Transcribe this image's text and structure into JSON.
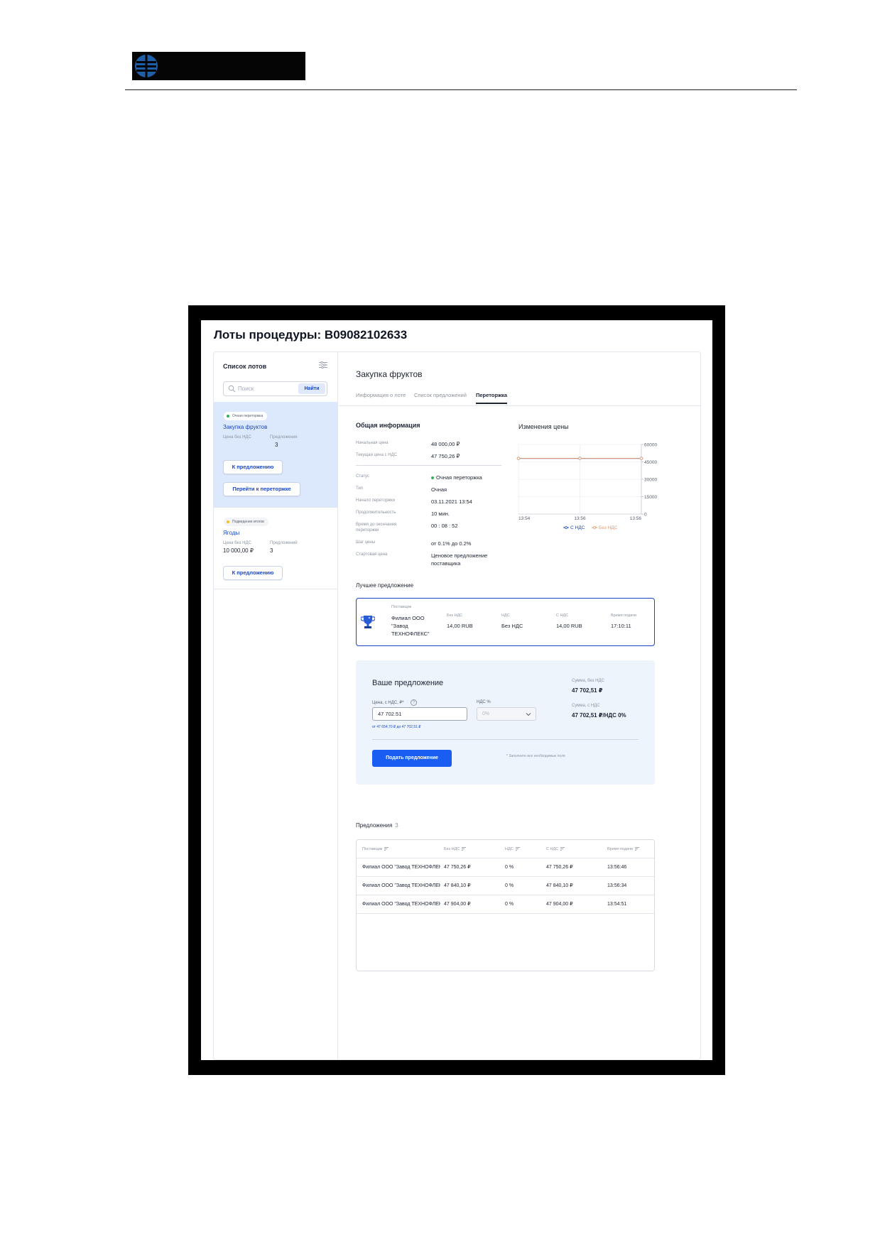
{
  "document": {
    "logo": {
      "brand_color": "#1f5fa8"
    }
  },
  "app": {
    "page_title": "Лоты процедуры: В09082102633"
  },
  "sidebar": {
    "title": "Список лотов",
    "search": {
      "placeholder": "Поиск",
      "button": "Найти"
    },
    "lots": [
      {
        "status": "Очная переторжка",
        "status_color": "#2db35a",
        "name": "Закупка фруктов",
        "price_label": "Цена без НДС",
        "price_value": "",
        "offers_label": "Предложения",
        "offers_value": "3",
        "button1": "К предложению",
        "button2": "Перейти к переторжке"
      },
      {
        "status": "Подведение итогов",
        "status_color": "#f2c21b",
        "name": "Ягоды",
        "price_label": "Цена без НДС",
        "price_value": "10 000,00 ₽",
        "offers_label": "Предложений",
        "offers_value": "3",
        "button1": "К предложению"
      }
    ]
  },
  "main": {
    "lot_title": "Закупка фруктов",
    "tabs": [
      {
        "label": "Информация о лоте"
      },
      {
        "label": "Список предложений"
      },
      {
        "label": "Переторжка",
        "active": true
      }
    ],
    "general_info": {
      "heading": "Общая информация",
      "rows": [
        {
          "key": "Начальная цена",
          "value": "48 000,00 ₽"
        },
        {
          "key": "Текущая цена с НДС",
          "value": "47 750,26 ₽"
        },
        {
          "key": "Статус",
          "value": "Очная переторжка"
        },
        {
          "key": "Тип",
          "value": "Очная"
        },
        {
          "key": "Начало переторжки",
          "value": "03.11.2021 13:54"
        },
        {
          "key": "Продолжительность",
          "value": "10 мин."
        },
        {
          "key": "Время до окончания переторжки",
          "value": "00 : 08 : 52"
        },
        {
          "key": "Шаг цены",
          "value": "от 0.1% до 0.2%"
        },
        {
          "key": "Стартовая цена",
          "value": "Ценовое предложение поставщика"
        }
      ]
    },
    "best_offer": {
      "heading": "Лучшее предложение",
      "supplier_label": "Поставщик",
      "supplier": "Филиал ООО \"Завод ТЕХНОФЛЕКС\"",
      "no_vat_label": "Без НДС",
      "no_vat": "14,00 RUB",
      "vat_label": "НДС",
      "vat": "Без НДС",
      "with_vat_label": "С НДС",
      "with_vat": "14,00 RUB",
      "time_label": "Время подачи",
      "time": "17:10:11"
    },
    "your_offer": {
      "title": "Ваше предложение",
      "price_label": "Цена, с НДС, ₽*",
      "price_value": "47 702.51",
      "vat_label": "НДС %",
      "vat_value": "0%",
      "range": "от 47 654,70 ₽ до 47 702,51 ₽",
      "sum_no_vat_label": "Сумма, без НДС",
      "sum_no_vat": "47 702,51 ₽",
      "sum_vat_label": "Сумма, с НДС",
      "sum_vat": "47 702,51 ₽/НДС 0%",
      "submit": "Подать предложение",
      "note": "* Заполните все необходимые поля",
      "help": "?"
    },
    "offers": {
      "heading": "Предложения",
      "count": "3",
      "columns": [
        "Поставщик",
        "Без НДС",
        "НДС",
        "С НДС",
        "Время подачи"
      ],
      "rows": [
        [
          "Филиал ООО \"Завод ТЕХНОФЛЕКС\"",
          "47 750,26 ₽",
          "0 %",
          "47 750,26 ₽",
          "13:56:46"
        ],
        [
          "Филиал ООО \"Завод ТЕХНОФЛЕКС\"",
          "47 840,10 ₽",
          "0 %",
          "47 840,10 ₽",
          "13:56:34"
        ],
        [
          "Филиал ООО \"Завод ТЕХНОФЛЕКС\"",
          "47 904,00 ₽",
          "0 %",
          "47 904,00 ₽",
          "13:54:51"
        ]
      ]
    }
  },
  "chart_data": {
    "type": "line",
    "title": "Изменения цены",
    "x": [
      "13:54",
      "13:56",
      "13:56"
    ],
    "series": [
      {
        "name": "С НДС",
        "color": "#1b48c4",
        "values": [
          48000,
          48000,
          48000
        ]
      },
      {
        "name": "Без НДС",
        "color": "#e39a6b",
        "values": [
          48000,
          48000,
          48000
        ]
      }
    ],
    "yticks": [
      "60000",
      "45000",
      "30000",
      "15000",
      "0"
    ],
    "ylim": [
      0,
      60000
    ],
    "y_axis_side": "right",
    "grid": true,
    "legend": "bottom"
  }
}
